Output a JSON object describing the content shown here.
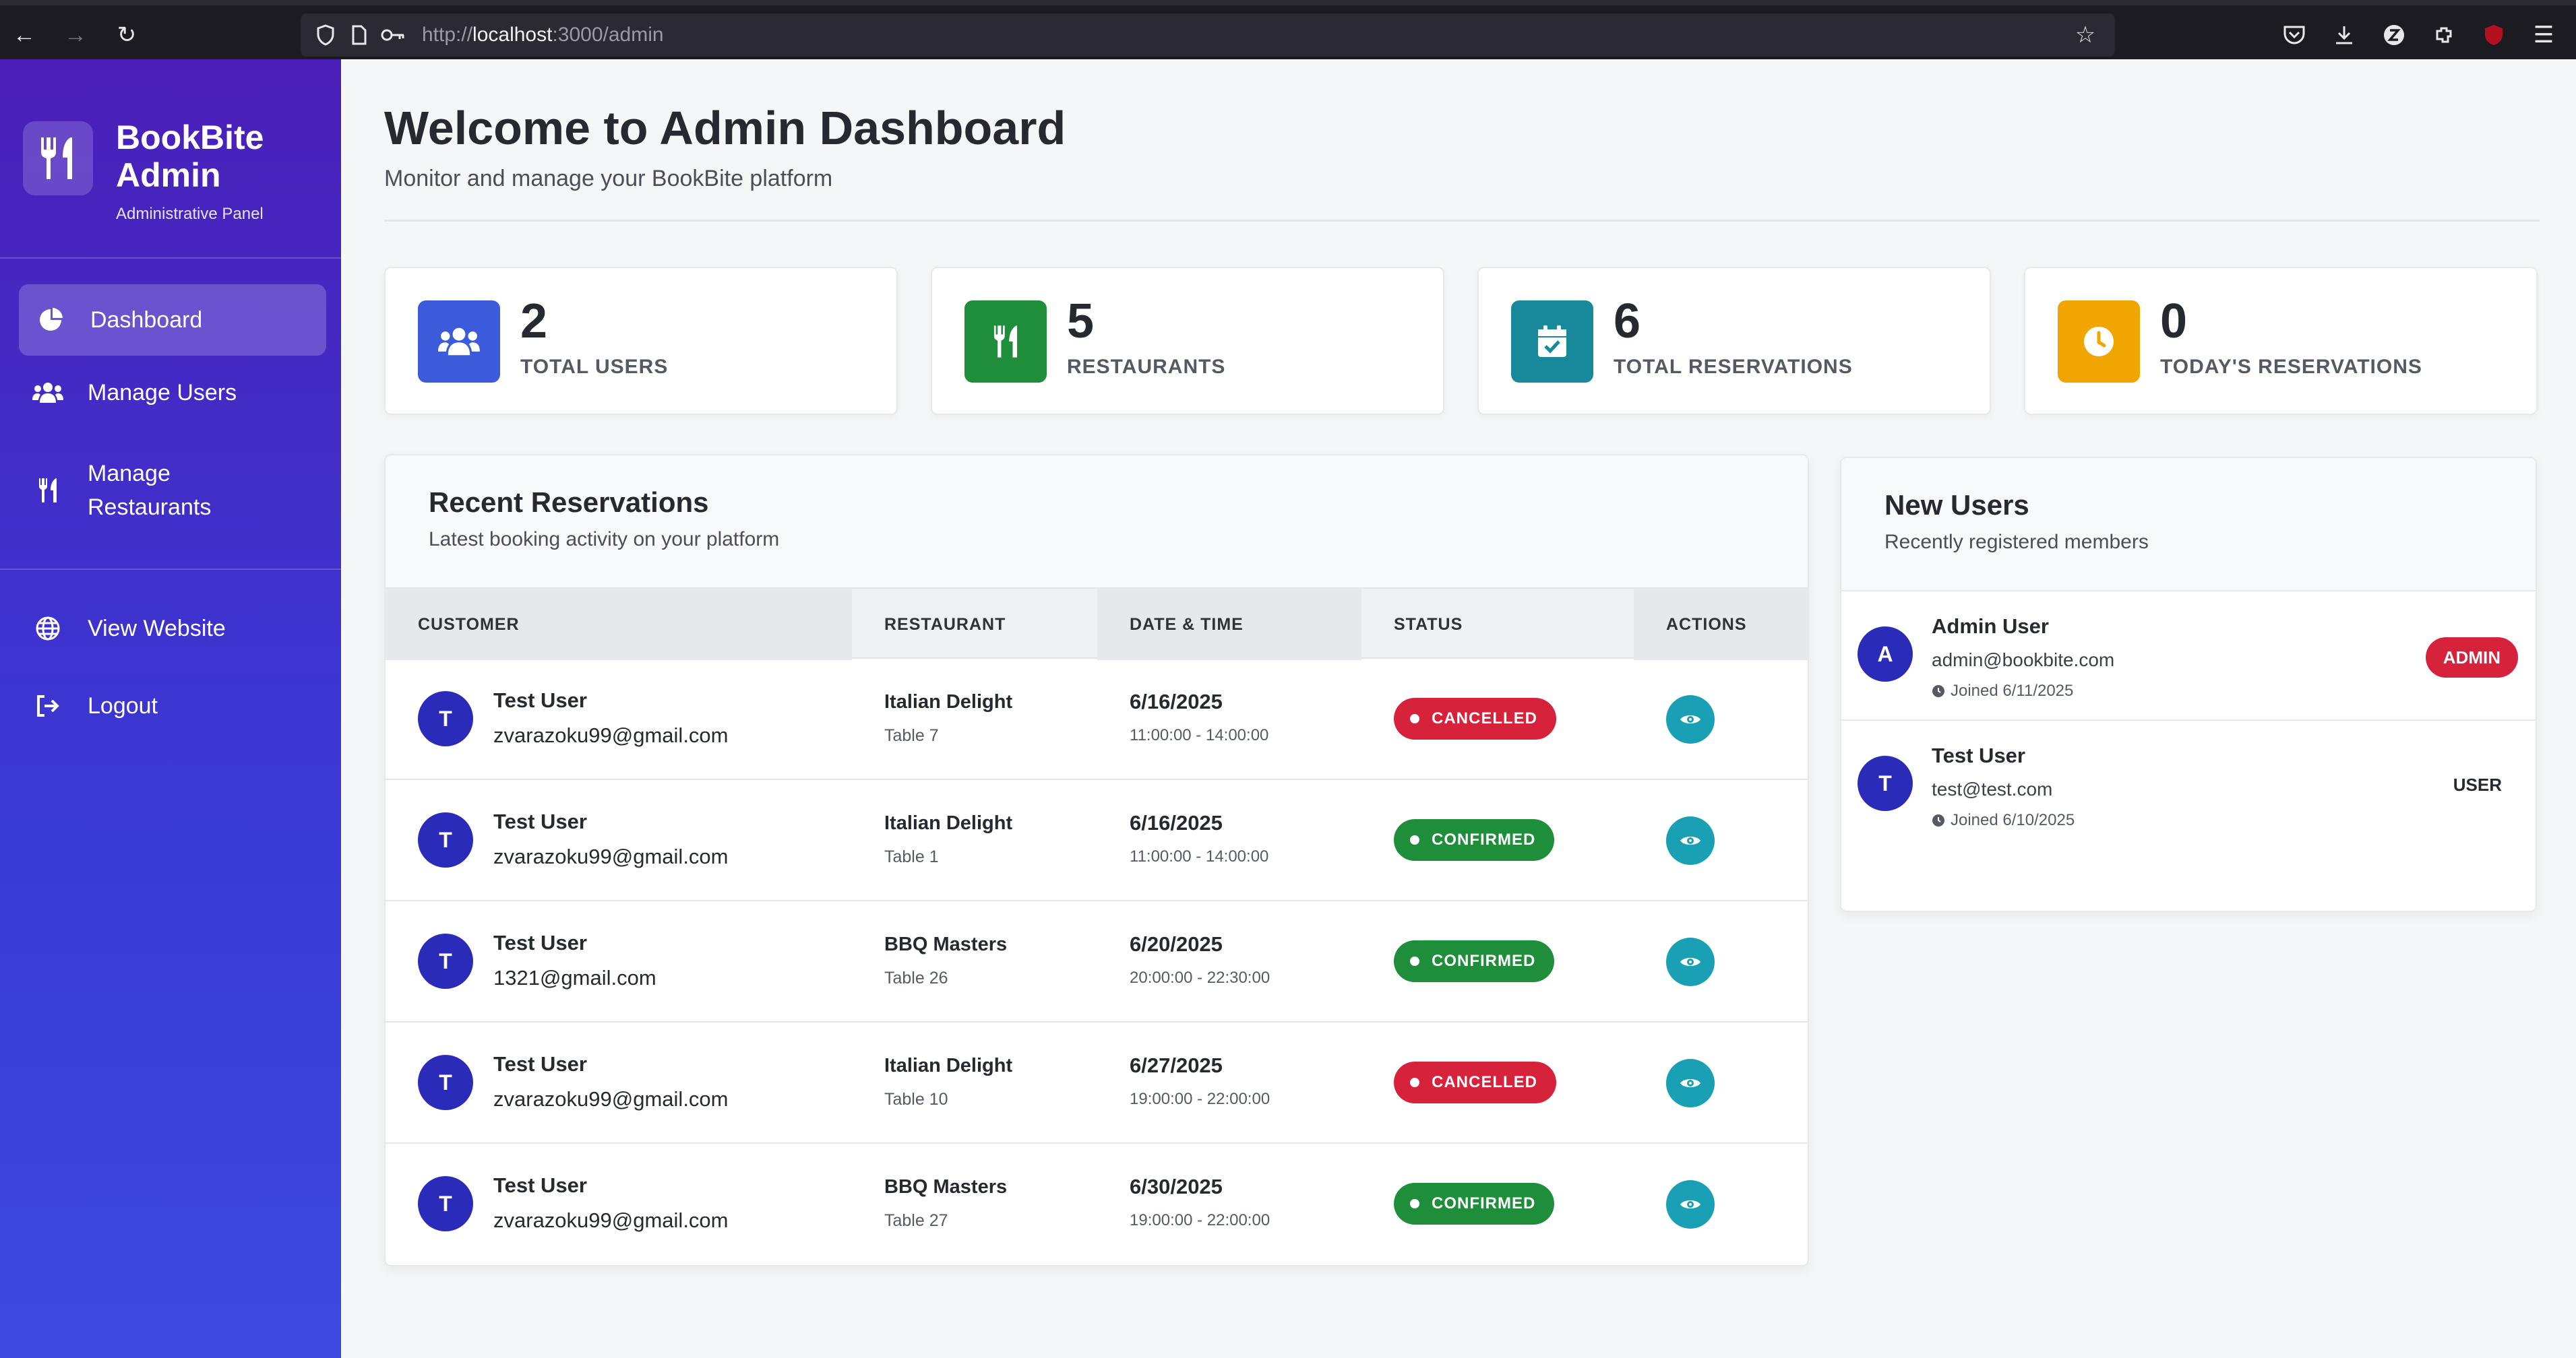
{
  "browser": {
    "url_prefix": "http://",
    "url_host": "localhost",
    "url_rest": ":3000/admin"
  },
  "sidebar": {
    "brand_title": "BookBite Admin",
    "brand_subtitle": "Administrative Panel",
    "items": [
      {
        "label": "Dashboard",
        "icon": "pie-chart-icon",
        "active": true
      },
      {
        "label": "Manage Users",
        "icon": "users-icon"
      },
      {
        "label": "Manage Restaurants",
        "icon": "utensils-icon"
      },
      {
        "label": "View Website",
        "icon": "globe-icon"
      },
      {
        "label": "Logout",
        "icon": "logout-icon"
      }
    ]
  },
  "header": {
    "title": "Welcome to Admin Dashboard",
    "subtitle": "Monitor and manage your BookBite platform"
  },
  "stats": [
    {
      "value": "2",
      "label": "TOTAL USERS",
      "color": "#3b5bdb",
      "icon": "users-icon"
    },
    {
      "value": "5",
      "label": "RESTAURANTS",
      "color": "#1f8e3b",
      "icon": "utensils-icon"
    },
    {
      "value": "6",
      "label": "TOTAL RESERVATIONS",
      "color": "#17899b",
      "icon": "calendar-check-icon"
    },
    {
      "value": "0",
      "label": "TODAY'S RESERVATIONS",
      "color": "#f0a500",
      "icon": "clock-icon"
    }
  ],
  "reservations": {
    "title": "Recent Reservations",
    "subtitle": "Latest booking activity on your platform",
    "columns": [
      "CUSTOMER",
      "RESTAURANT",
      "DATE & TIME",
      "STATUS",
      "ACTIONS"
    ],
    "rows": [
      {
        "initial": "T",
        "name": "Test User",
        "email": "zvarazoku99@gmail.com",
        "restaurant": "Italian Delight",
        "table": "Table 7",
        "date": "6/16/2025",
        "time": "11:00:00 - 14:00:00",
        "status": "CANCELLED"
      },
      {
        "initial": "T",
        "name": "Test User",
        "email": "zvarazoku99@gmail.com",
        "restaurant": "Italian Delight",
        "table": "Table 1",
        "date": "6/16/2025",
        "time": "11:00:00 - 14:00:00",
        "status": "CONFIRMED"
      },
      {
        "initial": "T",
        "name": "Test User",
        "email": "1321@gmail.com",
        "restaurant": "BBQ Masters",
        "table": "Table 26",
        "date": "6/20/2025",
        "time": "20:00:00 - 22:30:00",
        "status": "CONFIRMED"
      },
      {
        "initial": "T",
        "name": "Test User",
        "email": "zvarazoku99@gmail.com",
        "restaurant": "Italian Delight",
        "table": "Table 10",
        "date": "6/27/2025",
        "time": "19:00:00 - 22:00:00",
        "status": "CANCELLED"
      },
      {
        "initial": "T",
        "name": "Test User",
        "email": "zvarazoku99@gmail.com",
        "restaurant": "BBQ Masters",
        "table": "Table 27",
        "date": "6/30/2025",
        "time": "19:00:00 - 22:00:00",
        "status": "CONFIRMED"
      }
    ]
  },
  "new_users": {
    "title": "New Users",
    "subtitle": "Recently registered members",
    "users": [
      {
        "initial": "A",
        "name": "Admin User",
        "email": "admin@bookbite.com",
        "joined": "Joined 6/11/2025",
        "role": "ADMIN"
      },
      {
        "initial": "T",
        "name": "Test User",
        "email": "test@test.com",
        "joined": "Joined 6/10/2025",
        "role": "USER"
      }
    ]
  }
}
